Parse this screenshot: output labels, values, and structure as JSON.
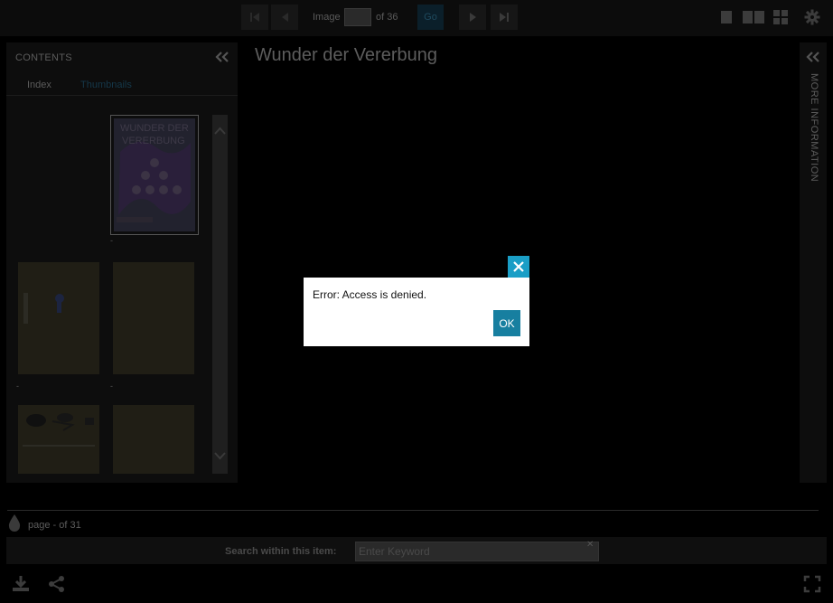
{
  "toolbar": {
    "image_label": "Image",
    "image_of": "of 36",
    "go_label": "Go",
    "icons": [
      "first-page-icon",
      "prev-page-icon",
      "next-page-icon",
      "last-page-icon",
      "single-page-view-icon",
      "two-page-view-icon",
      "gallery-view-icon",
      "settings-icon"
    ]
  },
  "contents": {
    "title": "CONTENTS",
    "tabs": [
      {
        "label": "Index"
      },
      {
        "label": "Thumbnails"
      }
    ],
    "thumbnails": [
      {
        "label": "-",
        "cover_text_1": "WUNDER DER",
        "cover_text_2": "VERERBUNG"
      },
      {
        "label": "-"
      },
      {
        "label": "-"
      },
      {
        "label": ""
      },
      {
        "label": ""
      }
    ]
  },
  "main": {
    "title": "Wunder der Vererbung"
  },
  "more_info": {
    "label": "MORE INFORMATION"
  },
  "page_info": {
    "text": "page - of 31"
  },
  "search": {
    "label": "Search within this item:",
    "placeholder": "Enter Keyword"
  },
  "dialog": {
    "message": "Error: Access is denied.",
    "ok_label": "OK"
  },
  "colors": {
    "accent": "#1a9ec6",
    "ok_button": "#177fa0",
    "background": "#000000"
  }
}
